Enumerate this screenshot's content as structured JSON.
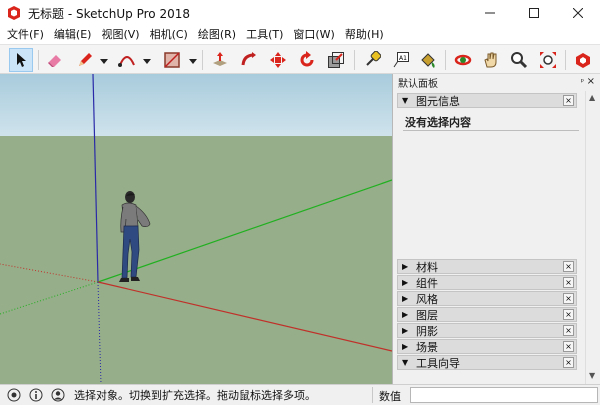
{
  "window": {
    "title": "无标题 - SketchUp Pro 2018",
    "icon": "sketchup-logo-icon",
    "brand_color": "#d9251c"
  },
  "menu": [
    {
      "label": "文件(F)"
    },
    {
      "label": "编辑(E)"
    },
    {
      "label": "视图(V)"
    },
    {
      "label": "相机(C)"
    },
    {
      "label": "绘图(R)"
    },
    {
      "label": "工具(T)"
    },
    {
      "label": "窗口(W)"
    },
    {
      "label": "帮助(H)"
    }
  ],
  "toolbar": {
    "tools": [
      {
        "icon": "select-arrow-icon",
        "selected": true
      },
      {
        "icon": "eraser-icon"
      },
      {
        "icon": "pencil-line-icon"
      },
      {
        "icon": "arc-icon"
      },
      {
        "icon": "rectangle-icon"
      },
      {
        "icon": "push-pull-icon"
      },
      {
        "icon": "follow-me-icon"
      },
      {
        "icon": "move-icon"
      },
      {
        "icon": "rotate-icon"
      },
      {
        "icon": "scale-icon"
      },
      {
        "icon": "tape-measure-icon"
      },
      {
        "icon": "text-label-icon"
      },
      {
        "icon": "paint-bucket-icon"
      },
      {
        "icon": "orbit-icon"
      },
      {
        "icon": "pan-hand-icon"
      },
      {
        "icon": "zoom-icon"
      },
      {
        "icon": "zoom-extents-icon"
      },
      {
        "icon": "extension-warehouse-icon"
      }
    ],
    "text_tool_glyph": "A1"
  },
  "viewport": {
    "sky_color": "#b5d3e1",
    "ground_color": "#96ae89",
    "axis_colors": {
      "red": "#c0302a",
      "green": "#20b020",
      "blue": "#2a2aa8"
    }
  },
  "panel": {
    "title": "默认面板",
    "pin_glyph": "ᵖ",
    "entity_info": {
      "label": "图元信息",
      "expanded": true,
      "message": "没有选择内容"
    },
    "trays": [
      {
        "label": "材料"
      },
      {
        "label": "组件"
      },
      {
        "label": "风格"
      },
      {
        "label": "图层"
      },
      {
        "label": "阴影"
      },
      {
        "label": "场景"
      },
      {
        "label": "工具向导",
        "expanded": true
      }
    ],
    "close_glyph": "×"
  },
  "status": {
    "hint": "选择对象。切换到扩充选择。拖动鼠标选择多项。",
    "measurements_label": "数值",
    "measurements_value": ""
  }
}
